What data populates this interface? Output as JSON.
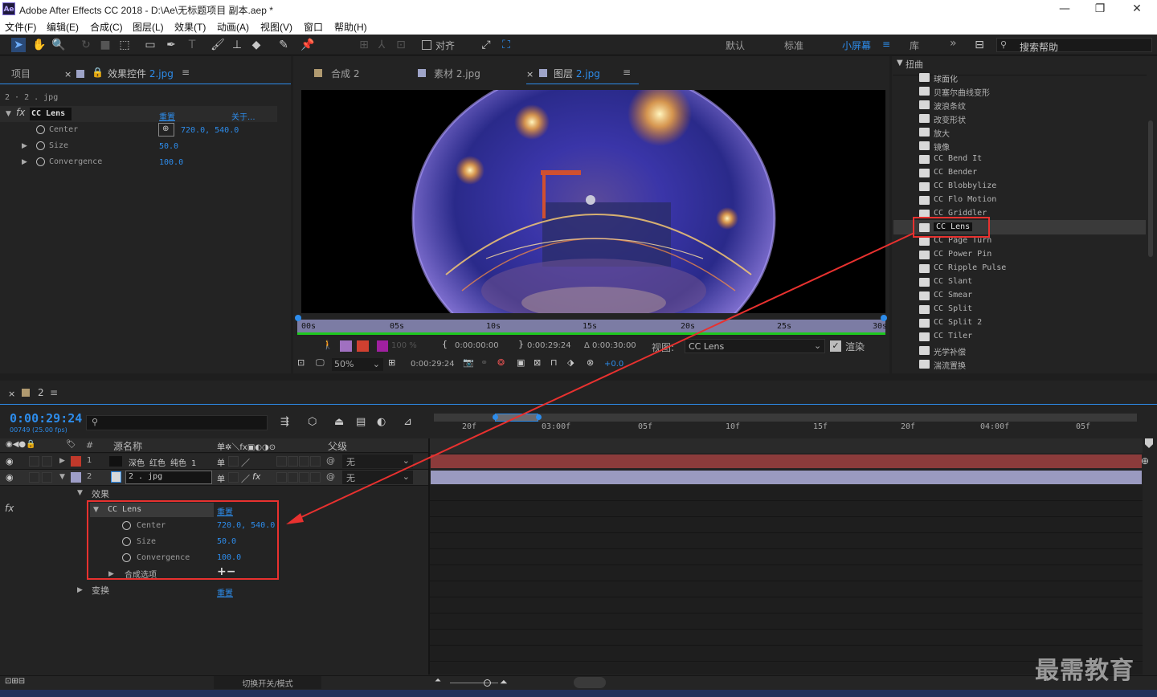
{
  "app": {
    "title": "Adobe After Effects CC 2018 - D:\\Ae\\无标题项目 副本.aep *",
    "logo": "Ae"
  },
  "menu": [
    "文件(F)",
    "编辑(E)",
    "合成(C)",
    "图层(L)",
    "效果(T)",
    "动画(A)",
    "视图(V)",
    "窗口",
    "帮助(H)"
  ],
  "toolbar": {
    "snap_label": "对齐",
    "workspaces": [
      "默认",
      "标准",
      "小屏幕",
      "库"
    ],
    "search_placeholder": "搜索帮助"
  },
  "project_tabs": {
    "project": "项目",
    "effect_controls": "效果控件",
    "effect_controls_layer": "2.jpg"
  },
  "effect_controls": {
    "breadcrumb": "2 · 2 . jpg",
    "effect_name": "CC Lens",
    "reset": "重置",
    "about": "关于...",
    "props": [
      {
        "name": "Center",
        "value": "720.0, 540.0"
      },
      {
        "name": "Size",
        "value": "50.0"
      },
      {
        "name": "Convergence",
        "value": "100.0"
      }
    ]
  },
  "viewer_tabs": [
    {
      "label": "合成",
      "suffix": "2"
    },
    {
      "label": "素材",
      "suffix": "2.jpg"
    },
    {
      "label": "图层",
      "suffix": "2.jpg"
    }
  ],
  "viewer": {
    "ruler_ticks": [
      "00s",
      "05s",
      "10s",
      "15s",
      "20s",
      "25s",
      "30s"
    ],
    "opacity": "100 %",
    "in_time": "0:00:00:00",
    "out_time": "0:00:29:24",
    "duration": "Δ 0:00:30:00",
    "view_label": "视图:",
    "view_value": "CC Lens",
    "render_label": "渲染",
    "zoom": "50%",
    "current_time": "0:00:29:24",
    "exposure": "+0.0"
  },
  "effects_panel": {
    "category": "扭曲",
    "items": [
      "球面化",
      "贝塞尔曲线变形",
      "波浪条纹",
      "改变形状",
      "放大",
      "镜像",
      "CC Bend It",
      "CC Bender",
      "CC Blobbylize",
      "CC Flo Motion",
      "CC Griddler",
      "CC Lens",
      "CC Page Turn",
      "CC Power Pin",
      "CC Ripple Pulse",
      "CC Slant",
      "CC Smear",
      "CC Split",
      "CC Split 2",
      "CC Tiler",
      "光学补偿",
      "湍流置换"
    ],
    "selected": "CC Lens"
  },
  "timeline": {
    "tab": "2",
    "timecode": "0:00:29:24",
    "fps": "00749 (25.00 fps)",
    "col_hash": "#",
    "col_source": "源名称",
    "col_parent": "父级",
    "layers": [
      {
        "num": "1",
        "name": "深色 红色 纯色 1",
        "parent": "无",
        "color": "#c0392b"
      },
      {
        "num": "2",
        "name": "2 . jpg",
        "parent": "无",
        "color": "#9e9ec8"
      }
    ],
    "effects_label": "效果",
    "effect_name": "CC Lens",
    "reset": "重置",
    "props": [
      {
        "name": "Center",
        "value": "720.0, 540.0"
      },
      {
        "name": "Size",
        "value": "50.0"
      },
      {
        "name": "Convergence",
        "value": "100.0"
      }
    ],
    "composite": "合成选项",
    "add_remove": "+−",
    "transform": "变换",
    "transform_reset": "重置",
    "ruler": [
      "20f",
      "03:00f",
      "05f",
      "10f",
      "15f",
      "20f",
      "04:00f",
      "05f"
    ],
    "toggle_mode": "切换开关/模式"
  },
  "watermark": "最需教育"
}
